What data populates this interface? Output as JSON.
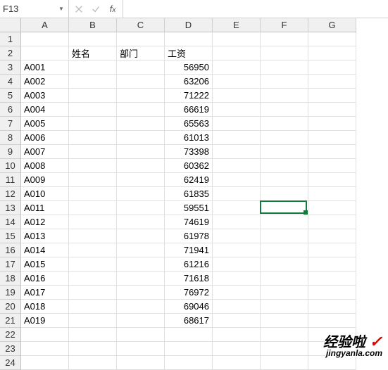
{
  "nameBox": "F13",
  "formulaValue": "",
  "columns": [
    "A",
    "B",
    "C",
    "D",
    "E",
    "F",
    "G"
  ],
  "headerRow": {
    "B": "姓名",
    "C": "部门",
    "D": "工资"
  },
  "rows": [
    {
      "n": 1
    },
    {
      "n": 2,
      "B": "姓名",
      "C": "部门",
      "D": "工资",
      "Dtext": true
    },
    {
      "n": 3,
      "A": "A001",
      "D": "56950"
    },
    {
      "n": 4,
      "A": "A002",
      "D": "63206"
    },
    {
      "n": 5,
      "A": "A003",
      "D": "71222"
    },
    {
      "n": 6,
      "A": "A004",
      "D": "66619"
    },
    {
      "n": 7,
      "A": "A005",
      "D": "65563"
    },
    {
      "n": 8,
      "A": "A006",
      "D": "61013"
    },
    {
      "n": 9,
      "A": "A007",
      "D": "73398"
    },
    {
      "n": 10,
      "A": "A008",
      "D": "60362"
    },
    {
      "n": 11,
      "A": "A009",
      "D": "62419"
    },
    {
      "n": 12,
      "A": "A010",
      "D": "61835"
    },
    {
      "n": 13,
      "A": "A011",
      "D": "59551"
    },
    {
      "n": 14,
      "A": "A012",
      "D": "74619"
    },
    {
      "n": 15,
      "A": "A013",
      "D": "61978"
    },
    {
      "n": 16,
      "A": "A014",
      "D": "71941"
    },
    {
      "n": 17,
      "A": "A015",
      "D": "61216"
    },
    {
      "n": 18,
      "A": "A016",
      "D": "71618"
    },
    {
      "n": 19,
      "A": "A017",
      "D": "76972"
    },
    {
      "n": 20,
      "A": "A018",
      "D": "69046"
    },
    {
      "n": 21,
      "A": "A019",
      "D": "68617"
    },
    {
      "n": 22
    },
    {
      "n": 23
    },
    {
      "n": 24
    }
  ],
  "selection": {
    "col": "F",
    "row": 13
  },
  "watermark": {
    "top": "经验啦",
    "check": "✓",
    "bottom": "jingyanla.com"
  }
}
